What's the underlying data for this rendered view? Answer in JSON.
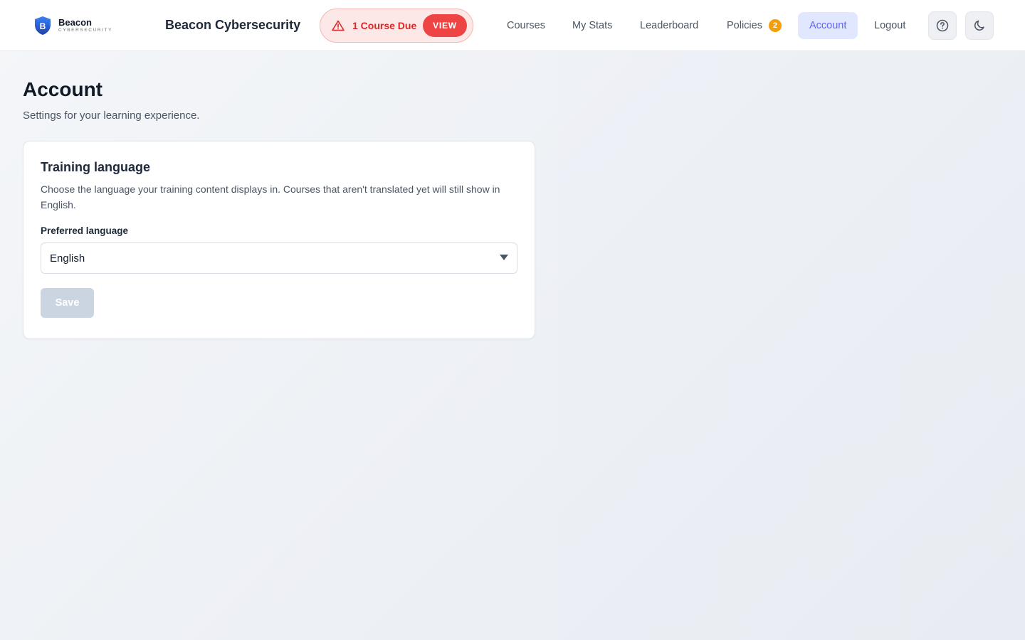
{
  "header": {
    "logo_name": "Beacon",
    "logo_sub": "CYBERSECURITY",
    "brand": "Beacon Cybersecurity",
    "due_alert": {
      "text": "1 Course Due",
      "action": "VIEW"
    },
    "nav": {
      "courses": "Courses",
      "my_stats": "My Stats",
      "leaderboard": "Leaderboard",
      "policies": "Policies",
      "policies_badge": "2",
      "account": "Account",
      "logout": "Logout"
    },
    "icons": {
      "help": "help-circle-icon",
      "theme": "moon-icon"
    }
  },
  "page": {
    "title": "Account",
    "subtitle": "Settings for your learning experience."
  },
  "card": {
    "title": "Training language",
    "description": "Choose the language your training content displays in. Courses that aren't translated yet will still show in English.",
    "field_label": "Preferred language",
    "selected_language": "English",
    "save_label": "Save"
  },
  "colors": {
    "accent": "#6366f1",
    "alert_red": "#ef4444",
    "badge_orange": "#f59e0b",
    "disabled_button": "#cbd5e1"
  }
}
